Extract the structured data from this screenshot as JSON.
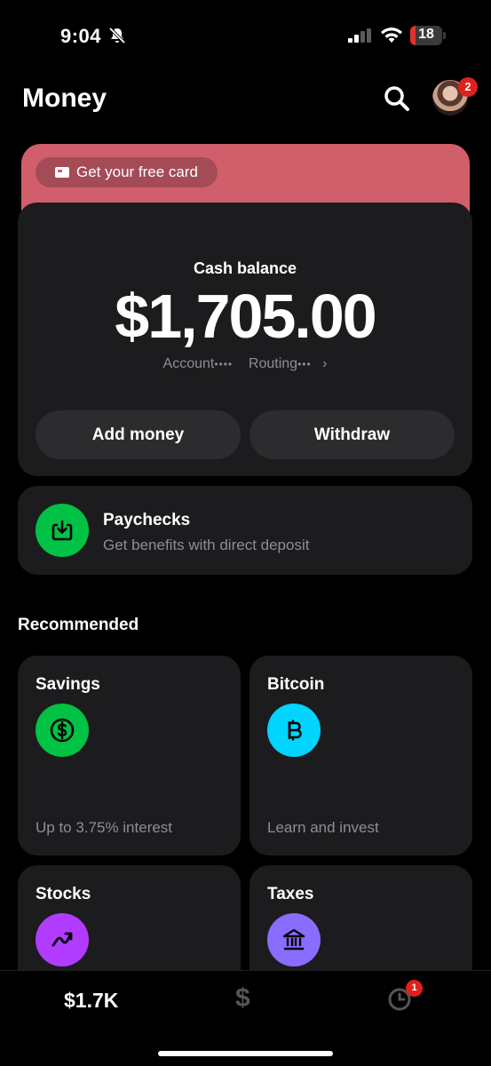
{
  "status_bar": {
    "time": "9:04",
    "battery": "18",
    "battery_level": 0.18
  },
  "header": {
    "title": "Money",
    "notification_count": "2"
  },
  "card_promo": {
    "label": "Get your free card",
    "color": "#d15e6b"
  },
  "balance": {
    "label": "Cash balance",
    "amount": "$1,705.00",
    "account_label": "Account",
    "account_dots": "••••",
    "routing_label": "Routing",
    "routing_dots": "•••",
    "add_money": "Add money",
    "withdraw": "Withdraw"
  },
  "paychecks": {
    "title": "Paychecks",
    "subtitle": "Get benefits with direct deposit",
    "icon_color": "#00c244"
  },
  "recommended": {
    "title": "Recommended",
    "tiles": [
      {
        "title": "Savings",
        "subtitle": "Up to 3.75% interest",
        "icon": "dollar-circle-icon",
        "color": "#00c244"
      },
      {
        "title": "Bitcoin",
        "subtitle": "Learn and invest",
        "icon": "bitcoin-icon",
        "color": "#00d4ff"
      },
      {
        "title": "Stocks",
        "subtitle": "",
        "icon": "trend-up-icon",
        "color": "#b13bff"
      },
      {
        "title": "Taxes",
        "subtitle": "",
        "icon": "bank-icon",
        "color": "#8a6cff"
      }
    ]
  },
  "bottom_nav": {
    "balance": "$1.7K",
    "dollar": "$",
    "activity_badge": "1"
  }
}
